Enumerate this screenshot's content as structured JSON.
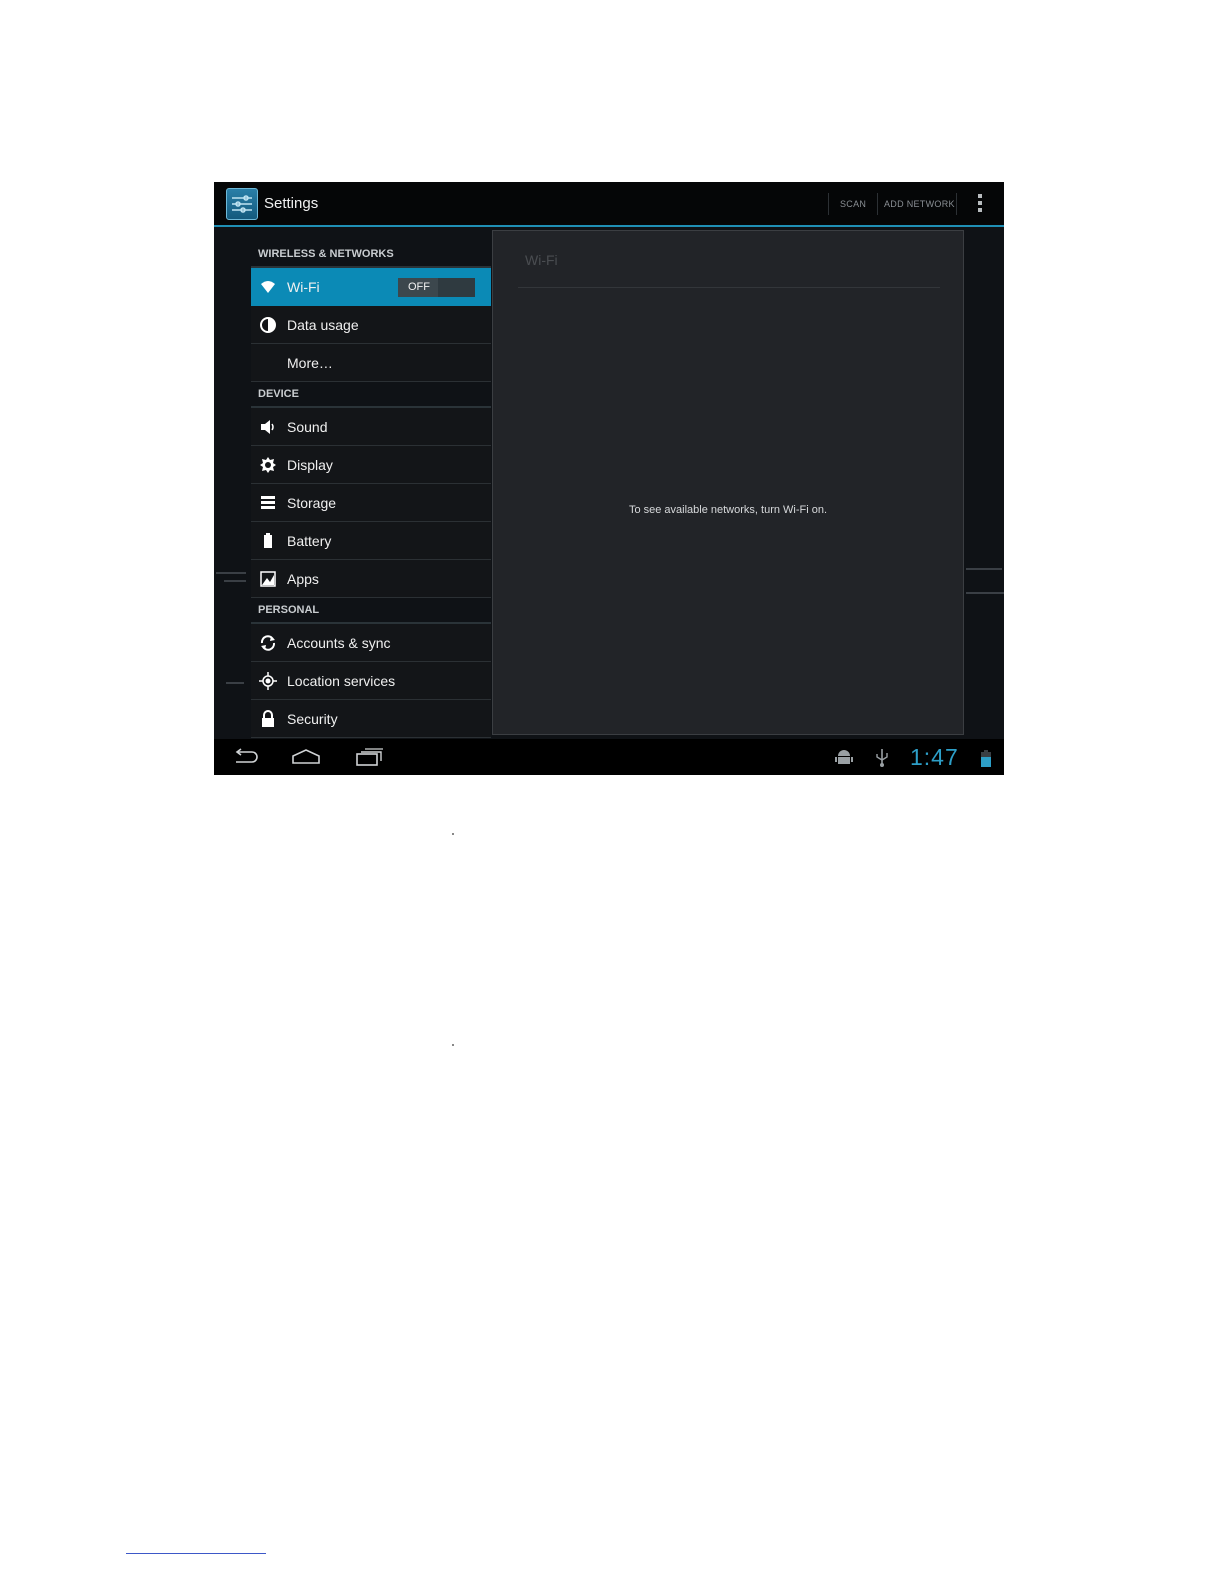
{
  "action_bar": {
    "title": "Settings",
    "actions": [
      {
        "label": "SCAN"
      },
      {
        "label": "ADD NETWORK"
      }
    ],
    "icons": {
      "app": "settings-app-icon",
      "overflow": "overflow-menu-icon"
    }
  },
  "sidebar": {
    "sections": [
      {
        "header": "WIRELESS & NETWORKS",
        "items": [
          {
            "label": "Wi-Fi",
            "icon": "wifi-icon",
            "selected": true,
            "toggle": "OFF"
          },
          {
            "label": "Data usage",
            "icon": "data-usage-icon"
          },
          {
            "label": "More…",
            "icon": ""
          }
        ]
      },
      {
        "header": "DEVICE",
        "items": [
          {
            "label": "Sound",
            "icon": "speaker-icon"
          },
          {
            "label": "Display",
            "icon": "brightness-icon"
          },
          {
            "label": "Storage",
            "icon": "storage-icon"
          },
          {
            "label": "Battery",
            "icon": "battery-icon"
          },
          {
            "label": "Apps",
            "icon": "apps-icon"
          }
        ]
      },
      {
        "header": "PERSONAL",
        "items": [
          {
            "label": "Accounts & sync",
            "icon": "sync-icon"
          },
          {
            "label": "Location services",
            "icon": "location-icon"
          },
          {
            "label": "Security",
            "icon": "lock-icon"
          }
        ]
      }
    ]
  },
  "detail": {
    "title": "Wi-Fi",
    "message": "To see available networks, turn Wi-Fi on."
  },
  "nav_bar": {
    "buttons": [
      "back-icon",
      "home-icon",
      "recent-apps-icon"
    ],
    "status_icons": [
      "android-debug-icon",
      "usb-icon",
      "battery-status-icon"
    ],
    "clock": "1:47"
  },
  "colors": {
    "accent": "#0b8ab6",
    "clock": "#2d9fc8",
    "background": "#0f1216"
  }
}
